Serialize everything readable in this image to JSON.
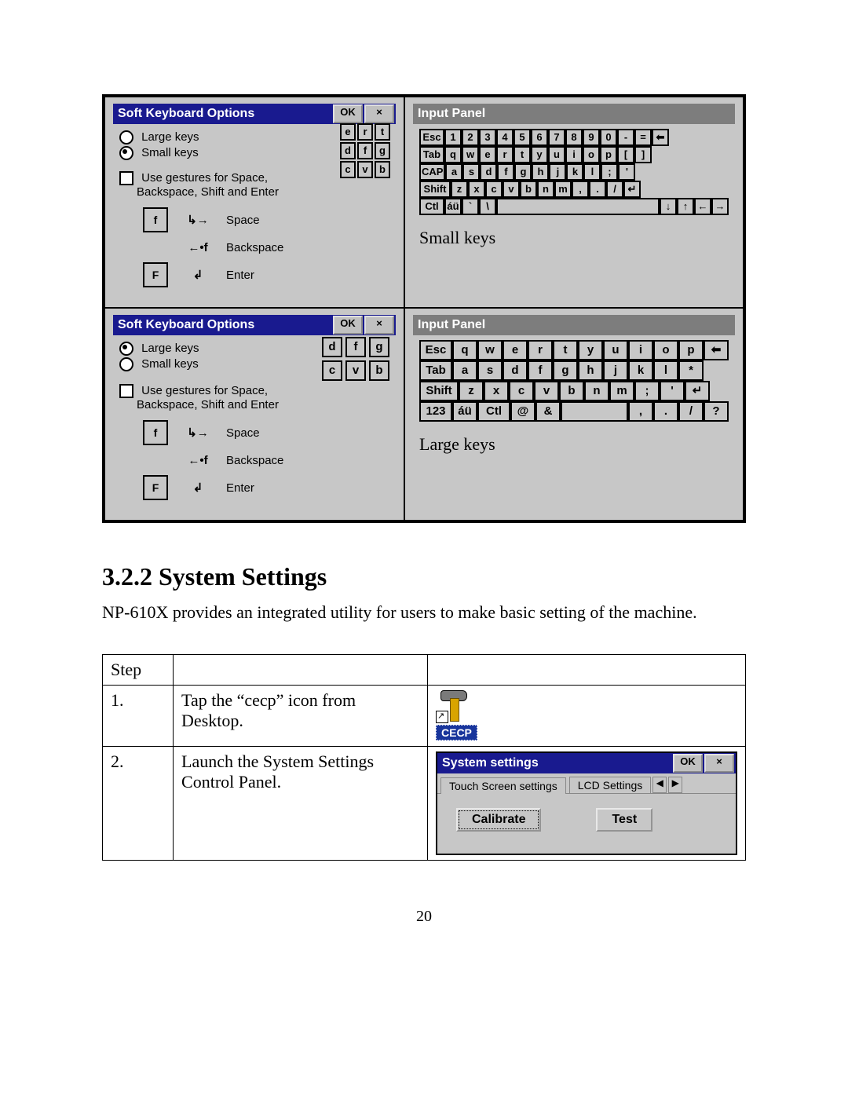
{
  "figure": {
    "soft_kbd_title": "Soft Keyboard Options",
    "ok": "OK",
    "close": "×",
    "large": "Large keys",
    "small": "Small keys",
    "use_gest": "Use gestures for Space,",
    "use_gest2": "Backspace, Shift and Enter",
    "gest_space": "Space",
    "gest_back": "Backspace",
    "gest_enter": "Enter",
    "gest_f_lower": "f",
    "gest_f_upper": "F",
    "sample_small": [
      "e",
      "r",
      "t",
      "d",
      "f",
      "g",
      "c",
      "v",
      "b"
    ],
    "sample_large": [
      "d",
      "f",
      "g",
      "c",
      "v",
      "b"
    ],
    "input_panel_title": "Input Panel",
    "small_caption": "Small keys",
    "large_caption": "Large keys",
    "kbd_small": {
      "row1": [
        "Esc",
        "1",
        "2",
        "3",
        "4",
        "5",
        "6",
        "7",
        "8",
        "9",
        "0",
        "-",
        "=",
        "⬅"
      ],
      "row2": [
        "Tab",
        "q",
        "w",
        "e",
        "r",
        "t",
        "y",
        "u",
        "i",
        "o",
        "p",
        "[",
        "]"
      ],
      "row3": [
        "CAP",
        "a",
        "s",
        "d",
        "f",
        "g",
        "h",
        "j",
        "k",
        "l",
        ";",
        "'"
      ],
      "row4": [
        "Shift",
        "z",
        "x",
        "c",
        "v",
        "b",
        "n",
        "m",
        ",",
        ".",
        "/",
        "↵"
      ],
      "row5": [
        "Ctl",
        "áü",
        "`",
        "\\",
        " ",
        "↓",
        "↑",
        "←",
        "→"
      ]
    },
    "kbd_large": {
      "row1": [
        "Esc",
        "q",
        "w",
        "e",
        "r",
        "t",
        "y",
        "u",
        "i",
        "o",
        "p",
        "⬅"
      ],
      "row2": [
        "Tab",
        "a",
        "s",
        "d",
        "f",
        "g",
        "h",
        "j",
        "k",
        "l",
        "*"
      ],
      "row3": [
        "Shift",
        "z",
        "x",
        "c",
        "v",
        "b",
        "n",
        "m",
        ";",
        "'",
        "↵"
      ],
      "row4": [
        "123",
        "áü",
        "Ctl",
        "@",
        "&",
        " ",
        ",",
        ".",
        "/",
        "?"
      ]
    }
  },
  "section": {
    "heading": "3.2.2 System Settings",
    "para": "NP-610X provides an integrated utility for users to make basic setting of the machine."
  },
  "table": {
    "h_step": "Step",
    "r1_n": "1.",
    "r1_desc": "Tap the “cecp” icon from Desktop.",
    "cecp_label": "CECP",
    "r2_n": "2.",
    "r2_desc": "Launch the System Settings Control Panel.",
    "sys_title": "System settings",
    "tab1": "Touch Screen settings",
    "tab2": "LCD Settings",
    "btn_cal": "Calibrate",
    "btn_test": "Test"
  },
  "pagenum": "20"
}
